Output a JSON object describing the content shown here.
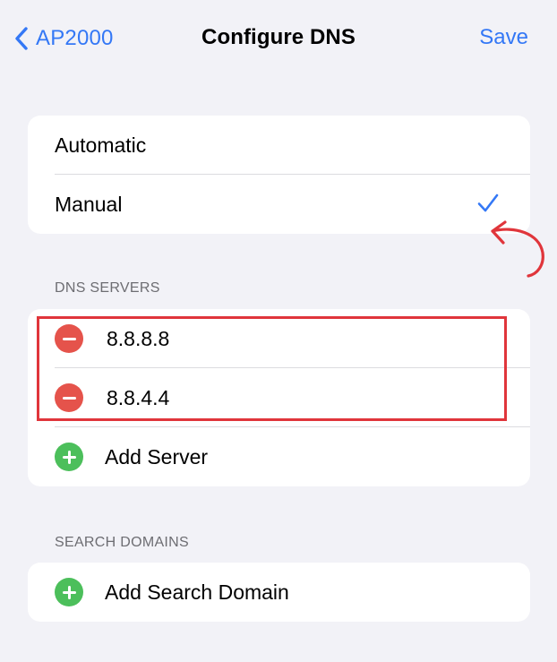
{
  "nav": {
    "back_label": "AP2000",
    "title": "Configure DNS",
    "save_label": "Save"
  },
  "mode_options": [
    {
      "label": "Automatic",
      "selected": false
    },
    {
      "label": "Manual",
      "selected": true
    }
  ],
  "dns_servers": {
    "header": "DNS SERVERS",
    "servers": [
      "8.8.8.8",
      "8.8.4.4"
    ],
    "add_label": "Add Server"
  },
  "search_domains": {
    "header": "SEARCH DOMAINS",
    "add_label": "Add Search Domain"
  },
  "colors": {
    "accent": "#3478f6",
    "remove": "#e5534b",
    "add": "#4cbf5b",
    "annotation": "#e0353b"
  }
}
